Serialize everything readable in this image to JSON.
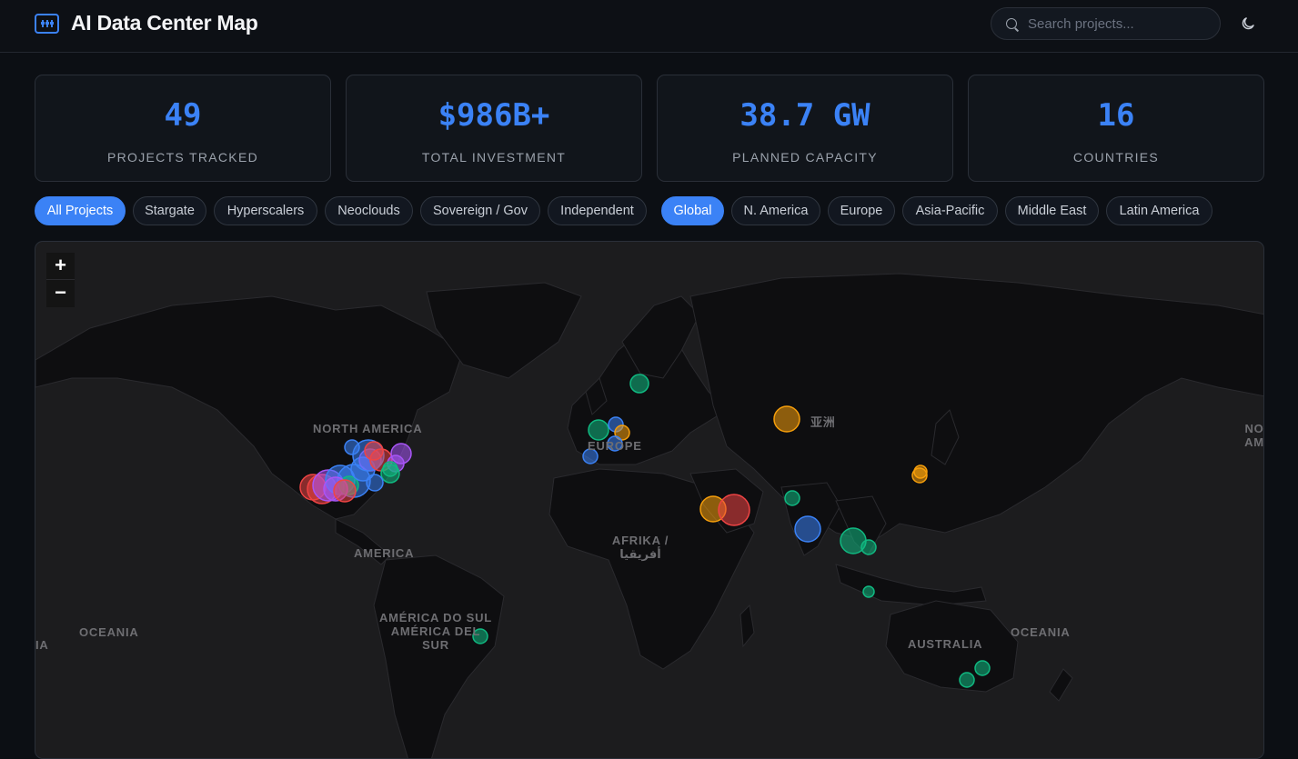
{
  "header": {
    "title": "AI Data Center Map",
    "search_placeholder": "Search projects...",
    "logo_icon": "server-icon",
    "theme_icon": "moon-icon"
  },
  "stats": [
    {
      "value": "49",
      "label": "PROJECTS TRACKED"
    },
    {
      "value": "$986B+",
      "label": "TOTAL INVESTMENT"
    },
    {
      "value": "38.7 GW",
      "label": "PLANNED CAPACITY"
    },
    {
      "value": "16",
      "label": "COUNTRIES"
    }
  ],
  "filters": {
    "categories": [
      "All Projects",
      "Stargate",
      "Hyperscalers",
      "Neoclouds",
      "Sovereign / Gov",
      "Independent"
    ],
    "active_category": "All Projects",
    "regions": [
      "Global",
      "N. America",
      "Europe",
      "Asia-Pacific",
      "Middle East",
      "Latin America"
    ],
    "active_region": "Global"
  },
  "map": {
    "zoom_in": "+",
    "zoom_out": "−",
    "labels": [
      "NORTH AMERICA",
      "EUROPE",
      "亚洲",
      "AFRIKA / أفريقيا",
      "AMERICA",
      "AMÉRICA DO SUL AMÉRICA DEL SUR",
      "OCEANIA",
      "AUSTRALIA",
      "OCEANIA",
      "NO AM",
      "IA"
    ],
    "colors": {
      "stargate": "#ef4444",
      "hyperscaler": "#3b82f6",
      "neocloud": "#a855f7",
      "sovereign": "#10b981",
      "independent": "#f59e0b",
      "land": "#0e0e10",
      "water": "#1c1c1e"
    }
  }
}
